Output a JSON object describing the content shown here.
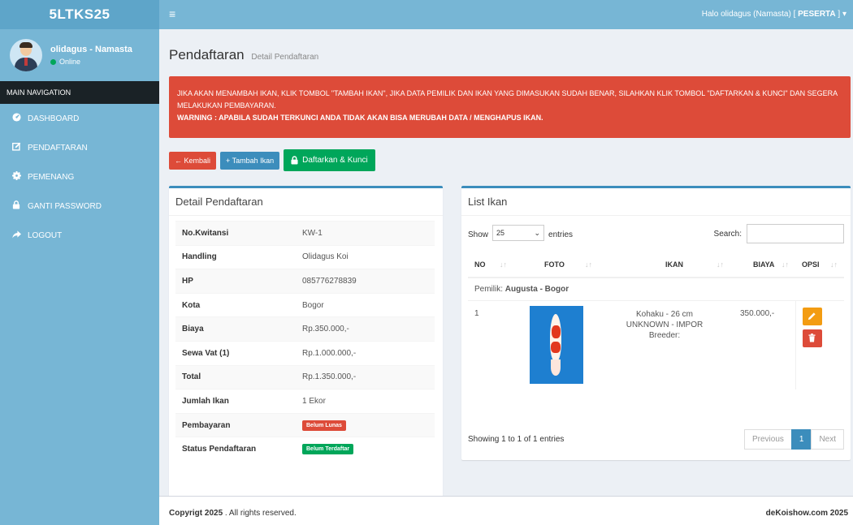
{
  "app": {
    "brand": "5LTKS25",
    "greeting_prefix": "Halo olidagus (Namasta) [",
    "greeting_role": "PESERTA",
    "greeting_suffix": "] ▾"
  },
  "user": {
    "name": "olidagus - Namasta",
    "status": "Online"
  },
  "sidebar": {
    "header": "MAIN NAVIGATION",
    "items": [
      {
        "label": "DASHBOARD",
        "icon": "dashboard-icon"
      },
      {
        "label": "PENDAFTARAN",
        "icon": "edit-icon"
      },
      {
        "label": "PEMENANG",
        "icon": "gear-icon"
      },
      {
        "label": "GANTI PASSWORD",
        "icon": "lock-icon"
      },
      {
        "label": "LOGOUT",
        "icon": "share-icon"
      }
    ]
  },
  "page": {
    "title": "Pendaftaran",
    "subtitle": "Detail Pendaftaran"
  },
  "alert": {
    "line1": "JIKA AKAN MENAMBAH IKAN, KLIK TOMBOL \"TAMBAH IKAN\", JIKA DATA PEMILIK DAN IKAN YANG DIMASUKAN SUDAH BENAR, SILAHKAN KLIK TOMBOL \"DAFTARKAN & KUNCI\" DAN SEGERA MELAKUKAN PEMBAYARAN.",
    "warning": "WARNING : APABILA SUDAH TERKUNCI ANDA TIDAK AKAN BISA MERUBAH DATA / MENGHAPUS IKAN."
  },
  "buttons": {
    "back": "← Kembali",
    "add_fish": "+ Tambah Ikan",
    "register_lock": "Daftarkan & Kunci"
  },
  "detail": {
    "title": "Detail Pendaftaran",
    "rows": [
      {
        "label": "No.Kwitansi",
        "value": "KW-1"
      },
      {
        "label": "Handling",
        "value": "Olidagus Koi"
      },
      {
        "label": "HP",
        "value": "085776278839"
      },
      {
        "label": "Kota",
        "value": "Bogor"
      },
      {
        "label": "Biaya",
        "value": "Rp.350.000,-"
      },
      {
        "label": "Sewa Vat (1)",
        "value": "Rp.1.000.000,-"
      },
      {
        "label": "Total",
        "value": "Rp.1.350.000,-"
      },
      {
        "label": "Jumlah Ikan",
        "value": "1 Ekor"
      },
      {
        "label": "Pembayaran",
        "badge": "Belum Lunas"
      },
      {
        "label": "Status Pendaftaran",
        "badge": "Belum Terdaftar"
      }
    ]
  },
  "list": {
    "title": "List Ikan",
    "show_label": "Show",
    "entries_value": "25",
    "entries_label": "entries",
    "search_label": "Search:",
    "search_value": "",
    "columns": [
      "NO",
      "FOTO",
      "IKAN",
      "BIAYA",
      "OPSI"
    ],
    "owner_prefix": "Pemilik:",
    "owner_name": "Augusta - Bogor",
    "rows": [
      {
        "no": "1",
        "ikan_line1": "Kohaku - 26 cm",
        "ikan_line2": "UNKNOWN - IMPOR",
        "ikan_line3": "Breeder:",
        "biaya": "350.000,-"
      }
    ],
    "info": "Showing 1 to 1 of 1 entries",
    "pager": {
      "previous": "Previous",
      "page": "1",
      "next": "Next"
    }
  },
  "footer": {
    "copyright_bold": "Copyrigt 2025",
    "copyright_rest": ". All rights reserved.",
    "site": "deKoishow.com 2025"
  },
  "colors": {
    "sidebar": "#77b6d5",
    "alert": "#dd4b39",
    "primary": "#3c8dbc",
    "success": "#00a65a",
    "warning": "#f39c12"
  }
}
